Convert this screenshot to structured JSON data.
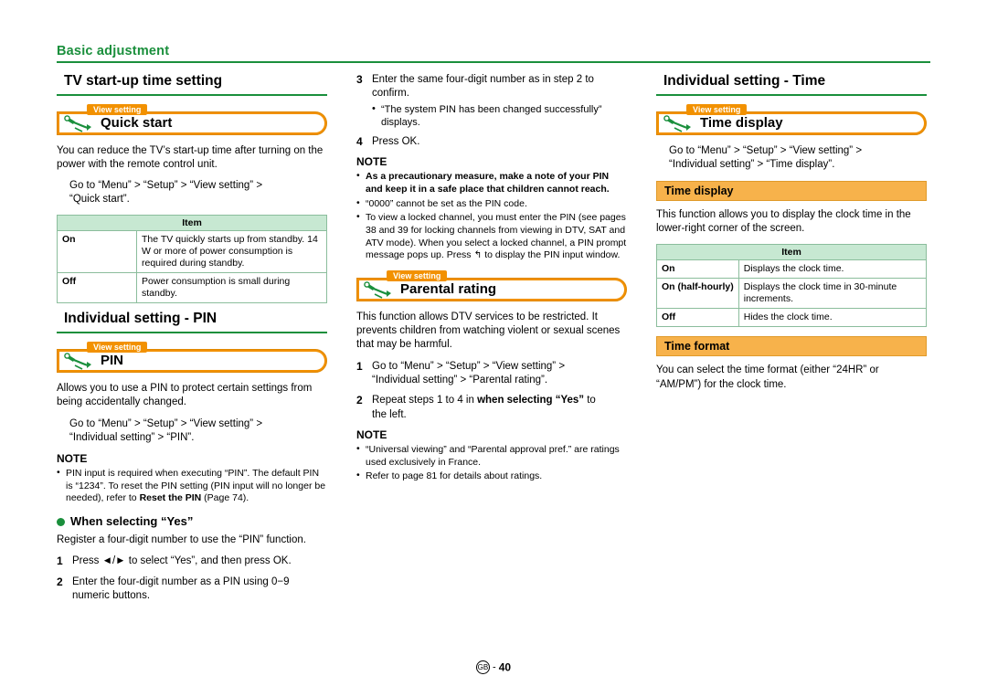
{
  "header": {
    "title": "Basic adjustment"
  },
  "footer": {
    "region": "GB",
    "sep": "-",
    "page": "40"
  },
  "labels": {
    "view_setting": "View setting",
    "note": "NOTE",
    "item_header": "Item"
  },
  "col1": {
    "section1_title": "TV start-up time setting",
    "banner1_text": "Quick start",
    "para1": "You can reduce the TV’s start-up time after turning on the power with the remote control unit.",
    "path1_line1": "Go to “Menu” > “Setup” > “View setting” >",
    "path1_line2": "“Quick start”.",
    "table1": {
      "header": "Item",
      "rows": [
        {
          "label": "On",
          "desc": "The TV quickly starts up from standby. 14 W or more of power consumption is required during standby."
        },
        {
          "label": "Off",
          "desc": "Power consumption is small during standby."
        }
      ]
    },
    "section2_title": "Individual setting - PIN",
    "banner2_text": "PIN",
    "para2": "Allows you to use a PIN to protect certain settings from being accidentally changed.",
    "path2_line1": "Go to “Menu” > “Setup” > “View setting” >",
    "path2_line2": "“Individual setting” > “PIN”.",
    "note_items": [
      "PIN input is required when executing “PIN”. The default PIN is “1234”. To reset the PIN setting (PIN input will no longer be needed), refer to Reset the PIN (Page 74)."
    ],
    "note_bold_1": "Reset the PIN",
    "dot_head": "When selecting “Yes”",
    "para3": "Register a four-digit number to use the “PIN” function.",
    "steps": [
      {
        "num": "1",
        "text": "Press ◄/► to select “Yes”, and then press OK."
      },
      {
        "num": "2",
        "text": "Enter the four-digit number as a PIN using 0−9 numeric buttons."
      }
    ]
  },
  "col2": {
    "step3_num": "3",
    "step3_text": "Enter the same four-digit number as in step 2 to confirm.",
    "step3_bullet": "“The system PIN has been changed successfully” displays.",
    "step4_num": "4",
    "step4_text": "Press OK.",
    "note_items": [
      "As a precautionary measure, make a note of your PIN and keep it in a safe place that children cannot reach.",
      "“0000” cannot be set as the PIN code.",
      "To view a locked channel, you must enter the PIN (see pages 38 and 39 for locking channels from viewing in DTV, SAT and ATV mode). When you select a locked channel, a PIN prompt message pops up. Press ↰ to display the PIN input window."
    ],
    "banner_text": "Parental rating",
    "para1": "This function allows DTV services to be restricted. It prevents children from watching violent or sexual scenes that may be harmful.",
    "steps": [
      {
        "num": "1",
        "line1": "Go to “Menu” > “Setup” > “View setting” >",
        "line2": "“Individual setting” > “Parental rating”."
      },
      {
        "num": "2",
        "line1": "Repeat steps 1 to 4 in when selecting “Yes” to",
        "line2": "the left."
      }
    ],
    "step2_bold": "when selecting “Yes”",
    "note2_items": [
      "“Universal viewing” and “Parental approval pref.” are ratings used exclusively in France.",
      "Refer to page 81 for details about ratings."
    ]
  },
  "col3": {
    "section_title": "Individual setting - Time",
    "banner_text": "Time display",
    "path_line1": "Go to “Menu” > “Setup” > “View setting” >",
    "path_line2": "“Individual setting” > “Time display”.",
    "sub1": "Time display",
    "para1": "This function allows you to display the clock time in the lower-right corner of the screen.",
    "table": {
      "header": "Item",
      "rows": [
        {
          "label": "On",
          "desc": "Displays the clock time."
        },
        {
          "label": "On (half-hourly)",
          "desc": "Displays the clock time in 30-minute increments."
        },
        {
          "label": "Off",
          "desc": "Hides the clock time."
        }
      ]
    },
    "sub2": "Time format",
    "para2": "You can select the time format (either “24HR” or “AM/PM”) for the clock time."
  }
}
